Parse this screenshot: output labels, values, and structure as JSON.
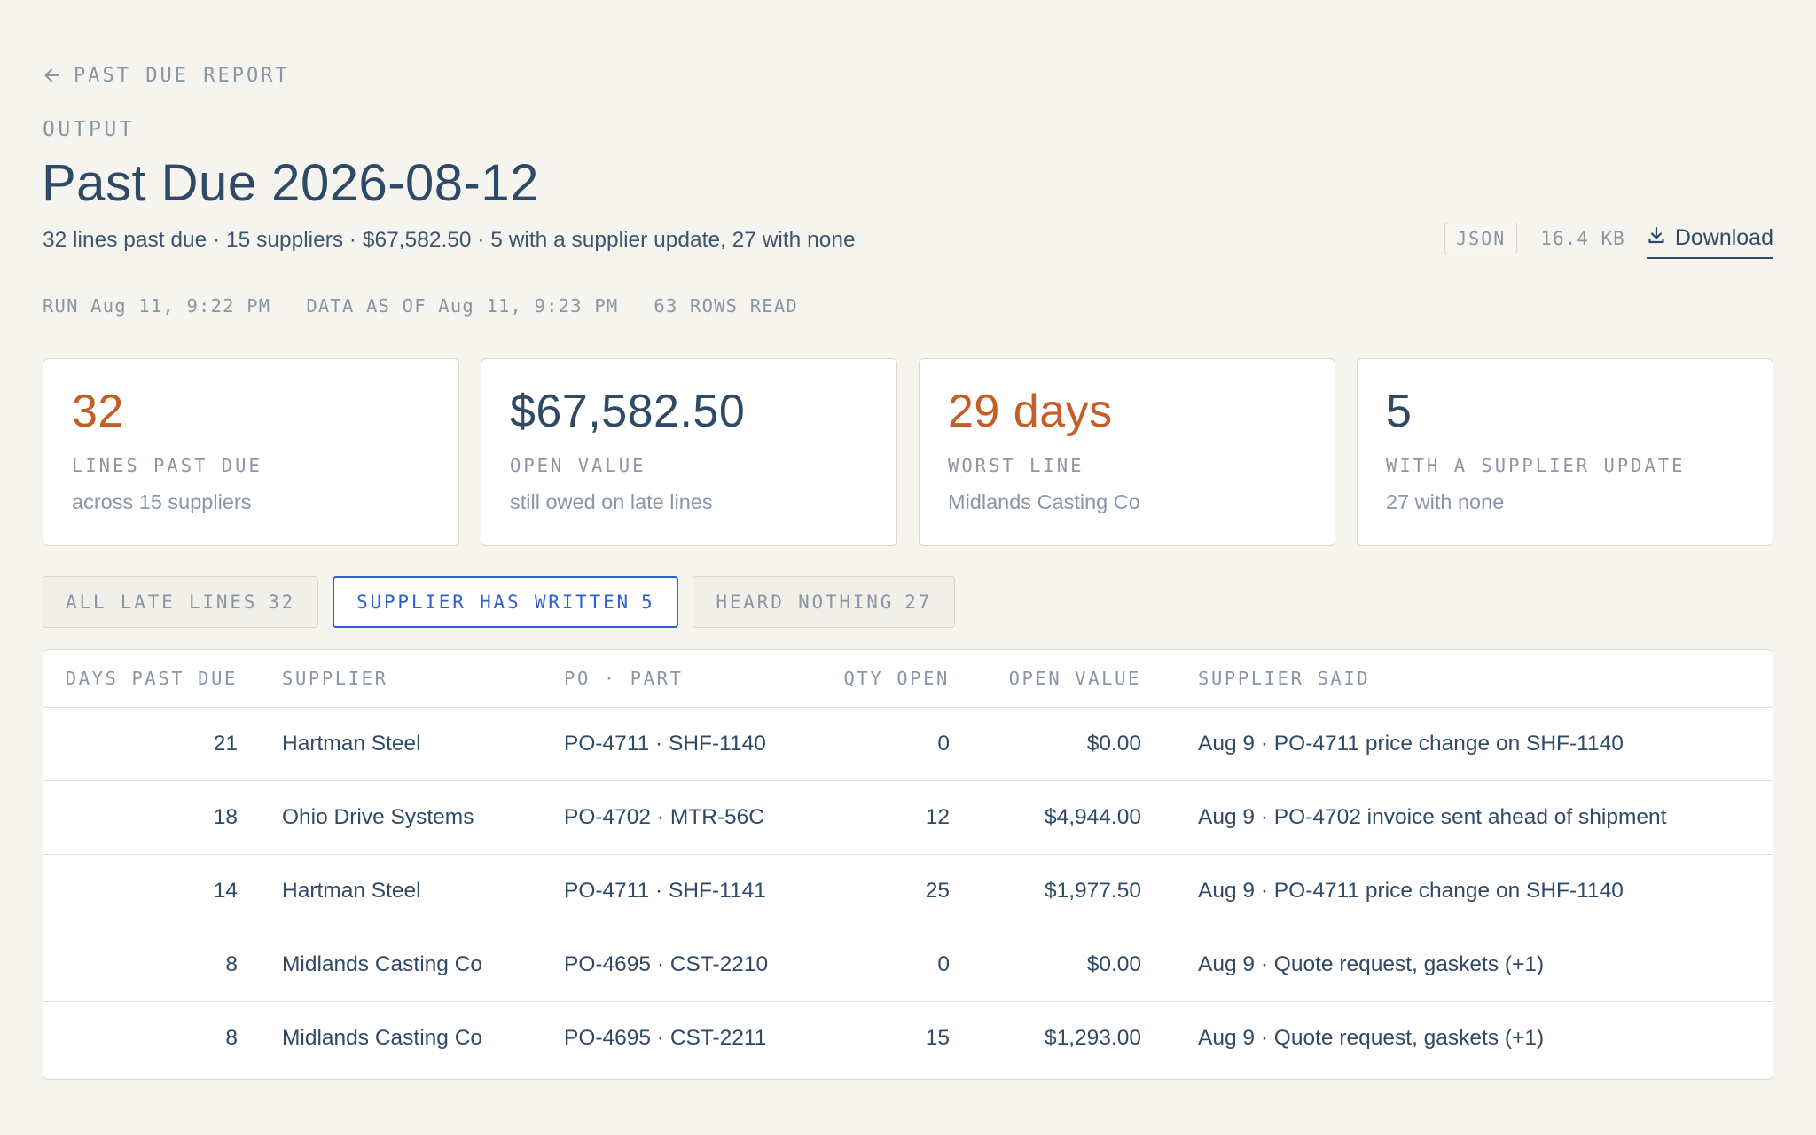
{
  "nav": {
    "back_label": "PAST DUE REPORT"
  },
  "header": {
    "eyebrow": "OUTPUT",
    "title": "Past Due 2026-08-12",
    "summary": "32 lines past due · 15 suppliers · $67,582.50 · 5 with a supplier update, 27 with none"
  },
  "file": {
    "format": "JSON",
    "size": "16.4 KB",
    "download_label": "Download"
  },
  "run_meta": {
    "run": "RUN Aug 11, 9:22 PM",
    "data_as_of": "DATA AS OF Aug 11, 9:23 PM",
    "rows_read": "63 ROWS READ"
  },
  "cards": [
    {
      "value": "32",
      "label": "LINES PAST DUE",
      "sub": "across 15 suppliers",
      "accent": true
    },
    {
      "value": "$67,582.50",
      "label": "OPEN VALUE",
      "sub": "still owed on late lines",
      "accent": false
    },
    {
      "value": "29 days",
      "label": "WORST LINE",
      "sub": "Midlands Casting Co",
      "accent": true
    },
    {
      "value": "5",
      "label": "WITH A SUPPLIER UPDATE",
      "sub": "27 with none",
      "accent": false
    }
  ],
  "tabs": [
    {
      "label": "ALL LATE LINES",
      "count": "32",
      "active": false
    },
    {
      "label": "SUPPLIER HAS WRITTEN",
      "count": "5",
      "active": true
    },
    {
      "label": "HEARD NOTHING",
      "count": "27",
      "active": false
    }
  ],
  "table": {
    "headers": {
      "days": "DAYS PAST DUE",
      "supplier": "SUPPLIER",
      "po_part": "PO · PART",
      "qty": "QTY OPEN",
      "value": "OPEN VALUE",
      "said": "SUPPLIER SAID"
    },
    "rows": [
      {
        "days": "21",
        "supplier": "Hartman Steel",
        "po_part": "PO-4711 · SHF-1140",
        "qty": "0",
        "value": "$0.00",
        "said": "Aug 9 · PO-4711 price change on SHF-1140"
      },
      {
        "days": "18",
        "supplier": "Ohio Drive Systems",
        "po_part": "PO-4702 · MTR-56C",
        "qty": "12",
        "value": "$4,944.00",
        "said": "Aug 9 · PO-4702 invoice sent ahead of shipment"
      },
      {
        "days": "14",
        "supplier": "Hartman Steel",
        "po_part": "PO-4711 · SHF-1141",
        "qty": "25",
        "value": "$1,977.50",
        "said": "Aug 9 · PO-4711 price change on SHF-1140"
      },
      {
        "days": "8",
        "supplier": "Midlands Casting Co",
        "po_part": "PO-4695 · CST-2210",
        "qty": "0",
        "value": "$0.00",
        "said": "Aug 9 · Quote request, gaskets (+1)"
      },
      {
        "days": "8",
        "supplier": "Midlands Casting Co",
        "po_part": "PO-4695 · CST-2211",
        "qty": "15",
        "value": "$1,293.00",
        "said": "Aug 9 · Quote request, gaskets (+1)"
      }
    ]
  },
  "colors": {
    "background": "#f5f4ef",
    "text": "#2f4a66",
    "muted": "#8a96a4",
    "accent_orange": "#c45e24",
    "active_blue": "#2f5fd0"
  },
  "icons": {
    "back": "arrow-left-icon",
    "download": "download-icon"
  }
}
